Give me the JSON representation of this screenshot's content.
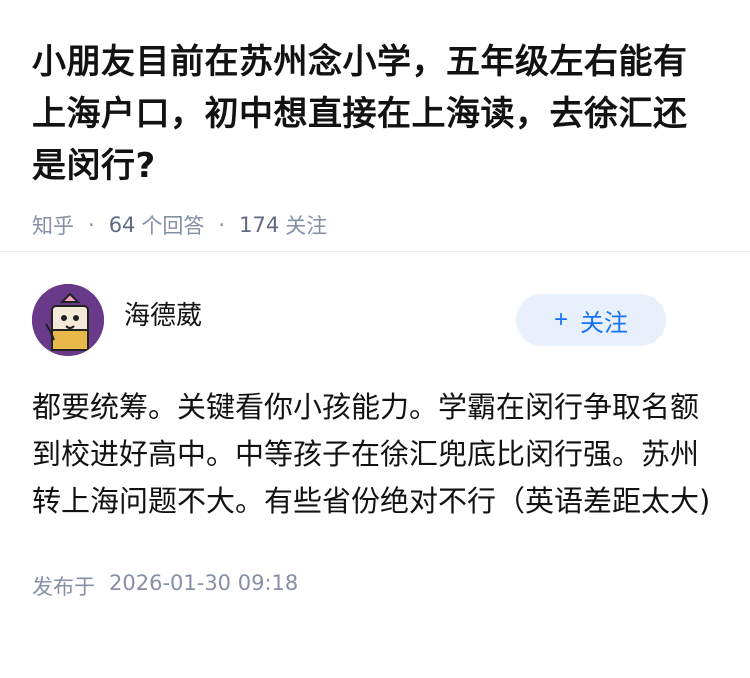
{
  "question": {
    "title": "小朋友目前在苏州念小学，五年级左右能有上海户口，初中想直接在上海读，去徐汇还是闵行?",
    "source": "知乎",
    "answer_count": "64",
    "answer_label": "个回答",
    "follow_count": "174",
    "follow_label": "关注"
  },
  "answer": {
    "author": "海德葳",
    "follow_button": "关注",
    "text": "都要统筹。关键看你小孩能力。学霸在闵行争取名额到校进好高中。中等孩子在徐汇兜底比闵行强。苏州转上海问题不大。有些省份绝对不行（英语差距太大)",
    "publish_label": "发布于",
    "publish_date": "2026-01-30 09:18"
  },
  "colors": {
    "accent": "#1772f6",
    "follow_bg": "#e8f1fb",
    "meta": "#8590a6",
    "avatar_bg": "#6a3a8a"
  },
  "icons": [
    "avatar-cartoon-icon",
    "plus-icon"
  ]
}
